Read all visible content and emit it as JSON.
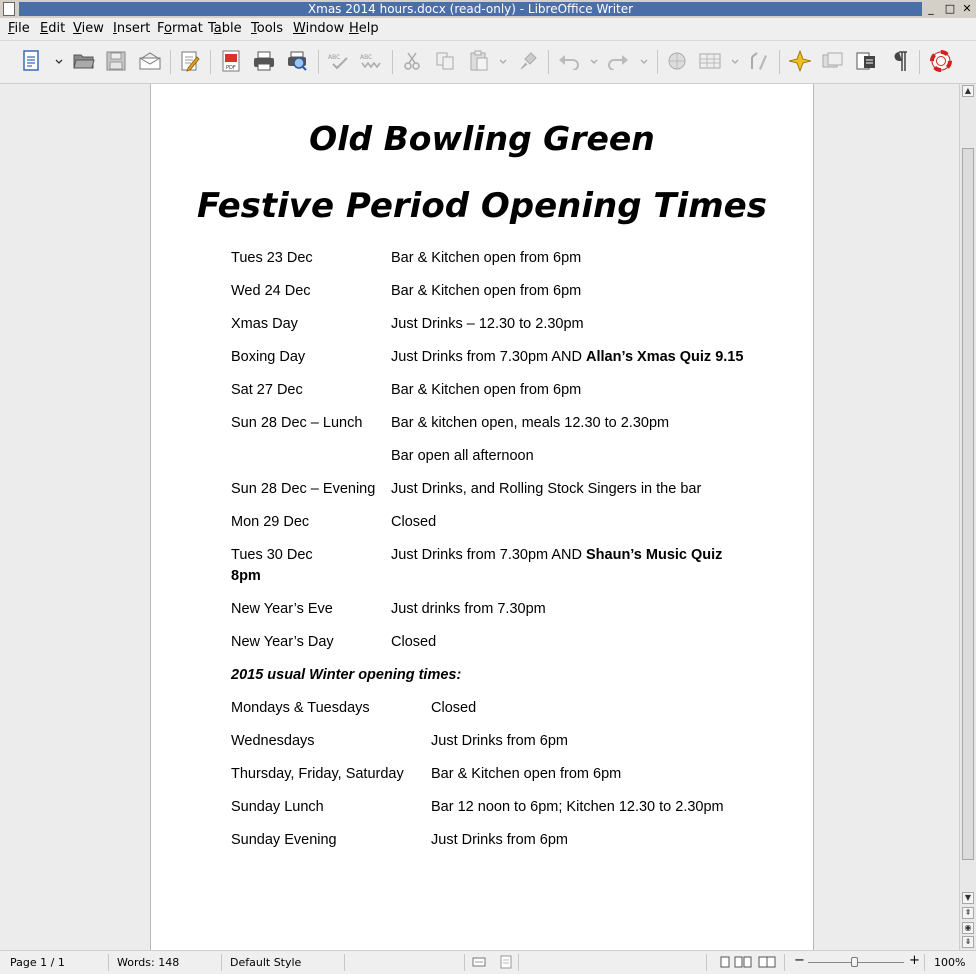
{
  "window": {
    "title": "Xmas 2014 hours.docx (read-only) - LibreOffice Writer",
    "controls": {
      "minimize": "_",
      "maximize": "□",
      "close": "✕"
    }
  },
  "menubar": {
    "items": [
      {
        "pre": "",
        "u": "F",
        "post": "ile"
      },
      {
        "pre": "",
        "u": "E",
        "post": "dit"
      },
      {
        "pre": "",
        "u": "V",
        "post": "iew"
      },
      {
        "pre": "",
        "u": "I",
        "post": "nsert"
      },
      {
        "pre": "F",
        "u": "o",
        "post": "rmat"
      },
      {
        "pre": "T",
        "u": "a",
        "post": "ble"
      },
      {
        "pre": "",
        "u": "T",
        "post": "ools"
      },
      {
        "pre": "",
        "u": "W",
        "post": "indow"
      },
      {
        "pre": "",
        "u": "H",
        "post": "elp"
      }
    ]
  },
  "document": {
    "title_line1": "Old  Bowling Green",
    "title_line2": "Festive Period Opening Times",
    "festive": [
      {
        "day": "Tues 23 Dec",
        "detail": "Bar & Kitchen open from 6pm",
        "bold": ""
      },
      {
        "day": "Wed 24 Dec",
        "detail": "Bar & Kitchen open from 6pm",
        "bold": ""
      },
      {
        "day": "Xmas Day",
        "detail": "Just Drinks – 12.30 to 2.30pm",
        "bold": ""
      },
      {
        "day": "Boxing Day",
        "detail": "Just Drinks from 7.30pm AND ",
        "bold": "Allan’s Xmas Quiz 9.15"
      },
      {
        "day": "Sat 27 Dec",
        "detail": "Bar & Kitchen open from 6pm",
        "bold": ""
      },
      {
        "day": "Sun 28 Dec – Lunch",
        "detail": "Bar & kitchen open, meals 12.30 to 2.30pm",
        "bold": ""
      },
      {
        "day": "",
        "detail": "Bar open all afternoon",
        "bold": ""
      },
      {
        "day": "Sun 28 Dec – Evening",
        "detail": "Just Drinks, and Rolling Stock Singers in the bar",
        "bold": ""
      },
      {
        "day": "Mon 29 Dec",
        "detail": "Closed",
        "bold": ""
      },
      {
        "day": "Tues 30 Dec",
        "detail": "Just Drinks from 7.30pm AND ",
        "bold": "Shaun’s Music Quiz"
      },
      {
        "day": "",
        "detail": "",
        "bold": "8pm"
      },
      {
        "day": "New Year’s Eve",
        "detail": "Just drinks from 7.30pm",
        "bold": ""
      },
      {
        "day": "New Year’s Day",
        "detail": "Closed",
        "bold": ""
      }
    ],
    "winter_heading": "2015 usual Winter opening times:",
    "winter": [
      {
        "day": "Mondays & Tuesdays",
        "detail": "Closed"
      },
      {
        "day": "Wednesdays",
        "detail": "Just Drinks from 6pm"
      },
      {
        "day": "Thursday, Friday, Saturday",
        "detail": "Bar & Kitchen open from 6pm"
      },
      {
        "day": "Sunday Lunch",
        "detail": "Bar 12 noon to 6pm;  Kitchen 12.30 to 2.30pm"
      },
      {
        "day": "Sunday Evening",
        "detail": "Just Drinks from 6pm"
      }
    ]
  },
  "statusbar": {
    "page": "Page 1 / 1",
    "words": "Words: 148",
    "style": "Default Style",
    "zoom": "100%"
  },
  "icons": {
    "toolbar": [
      "new-document-icon",
      "open-folder-icon",
      "save-icon",
      "email-icon",
      "edit-document-icon",
      "export-pdf-icon",
      "print-icon",
      "print-preview-icon",
      "spellcheck-icon",
      "autospellcheck-icon",
      "cut-icon",
      "copy-icon",
      "paste-icon",
      "clone-formatting-icon",
      "undo-icon",
      "redo-icon",
      "hyperlink-icon",
      "table-icon",
      "draw-functions-icon",
      "navigator-icon",
      "gallery-icon",
      "data-sources-icon",
      "formatting-marks-icon",
      "help-icon"
    ]
  }
}
